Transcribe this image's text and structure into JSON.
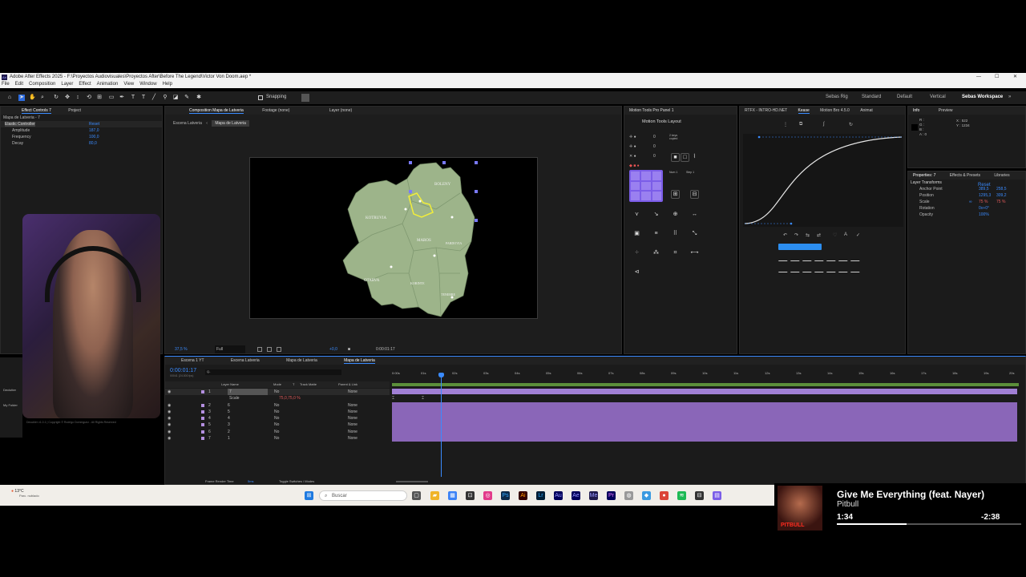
{
  "titlebar": {
    "title": "Adobe After Effects 2025 - F:\\Proyectos Audiovisuales\\Proyectos After\\Before The Legend\\Victor Von Doom.aep *"
  },
  "menu": [
    "File",
    "Edit",
    "Composition",
    "Layer",
    "Effect",
    "Animation",
    "View",
    "Window",
    "Help"
  ],
  "toolbar": {
    "snapping_label": "Snapping",
    "workspaces": [
      "Sebas Rig",
      "Standard",
      "Default",
      "Vertical",
      "Sebas Workspace"
    ]
  },
  "effect_controls": {
    "tabs": [
      "Effect Controls 7",
      "Project"
    ],
    "layer": "Mapa de Latveria - 7",
    "effect_name": "Elastic Controller",
    "reset": "Reset",
    "props": [
      {
        "name": "Amplitude",
        "value": "187,0"
      },
      {
        "name": "Frequency",
        "value": "100,0"
      },
      {
        "name": "Decay",
        "value": "80,0"
      }
    ]
  },
  "webcam_credit": "Decubler v1.0.1 | Copyright © Rodrigo Domínguez - All Rights Reserved",
  "left_stub": [
    "Declutter",
    "My Folder"
  ],
  "composition": {
    "tabs": [
      "Composition Mapa de Latveria",
      "Footage (none)",
      "Layer (none)"
    ],
    "crumbs": [
      "Escena Latveria",
      "Mapa de Latveria"
    ],
    "zoom": "37,5 %",
    "quality": "Full",
    "timecode": "0:00:01:17",
    "exposure": "+0,0",
    "map_labels": [
      "BOLENY",
      "KOTRUVIA",
      "MAROS",
      "PARDOVIA",
      "OTARVA",
      "KORINTE",
      "TENEBRE"
    ]
  },
  "motion_tools": {
    "tab": "Motion Tools Pro Panel 1",
    "title": "Motion Tools Layout",
    "values": [
      "0",
      "0",
      "0"
    ],
    "labels": [
      "2 keys copied",
      "Num 1",
      "Step 1"
    ]
  },
  "ease": {
    "tabs": [
      "RTFX - INTRO-HD.NET",
      "Kease",
      "Motion Bro 4.5.0",
      "Animat"
    ]
  },
  "info": {
    "tabs": [
      "Info",
      "Preview"
    ],
    "rgb": [
      "R :",
      "G :",
      "B :",
      "A : 0"
    ],
    "x": "X : 522",
    "y": "Y : 1234"
  },
  "properties": {
    "tabs": [
      "Properties: 7",
      "Effects & Presets",
      "Libraries"
    ],
    "section": "Layer Transforms",
    "reset": "Reset",
    "props": [
      {
        "name": "Anchor Point",
        "v1": "389,5",
        "v2": "258,5"
      },
      {
        "name": "Position",
        "v1": "1295,3",
        "v2": "309,2"
      },
      {
        "name": "Scale",
        "v1": "75 %",
        "v2": "75 %"
      },
      {
        "name": "Rotation",
        "v1": "0x+0°",
        "v2": ""
      },
      {
        "name": "Opacity",
        "v1": "100%",
        "v2": ""
      }
    ]
  },
  "timeline": {
    "tabs": [
      "Escena 1 YT",
      "Escena Latveria",
      "Mapa de Latveria",
      "Mapa de Latveria"
    ],
    "timecode": "0:00:01:17",
    "sub_timecode": "00041 (24.000 fps)",
    "search_placeholder": "Q-",
    "col_headers": [
      "Layer Name",
      "Mode",
      "T",
      "Track Matte",
      "Parent & Link"
    ],
    "layers": [
      {
        "num": "1",
        "name": "7",
        "mode": "No",
        "parent": "None"
      },
      {
        "num": "",
        "name": "Scale",
        "mode": "",
        "parent": ""
      },
      {
        "num": "2",
        "name": "6",
        "mode": "No",
        "parent": "None"
      },
      {
        "num": "3",
        "name": "5",
        "mode": "No",
        "parent": "None"
      },
      {
        "num": "4",
        "name": "4",
        "mode": "No",
        "parent": "None"
      },
      {
        "num": "5",
        "name": "3",
        "mode": "No",
        "parent": "None"
      },
      {
        "num": "6",
        "name": "2",
        "mode": "No",
        "parent": "None"
      },
      {
        "num": "7",
        "name": "1",
        "mode": "No",
        "parent": "None"
      }
    ],
    "scale_value": "75,0,75,0 %",
    "ruler": [
      "0:00s",
      "01s",
      "02s",
      "03s",
      "04s",
      "05s",
      "06s",
      "07s",
      "08s",
      "09s",
      "10s",
      "11s",
      "12s",
      "13s",
      "14s",
      "15s",
      "16s",
      "17s",
      "18s",
      "19s",
      "20s"
    ],
    "footer_render": "Frame Render Time",
    "footer_render_val": "5ms",
    "footer_toggle": "Toggle Switches / Modes"
  },
  "taskbar": {
    "weather": "13°C",
    "weather_sub": "Parc. nublado",
    "search": "Buscar"
  },
  "music": {
    "title": "Give Me Everything (feat. Nayer)",
    "artist": "Pitbull",
    "elapsed": "1:34",
    "remaining": "-2:38",
    "progress": 0.38,
    "art_text": "PITBULL"
  }
}
